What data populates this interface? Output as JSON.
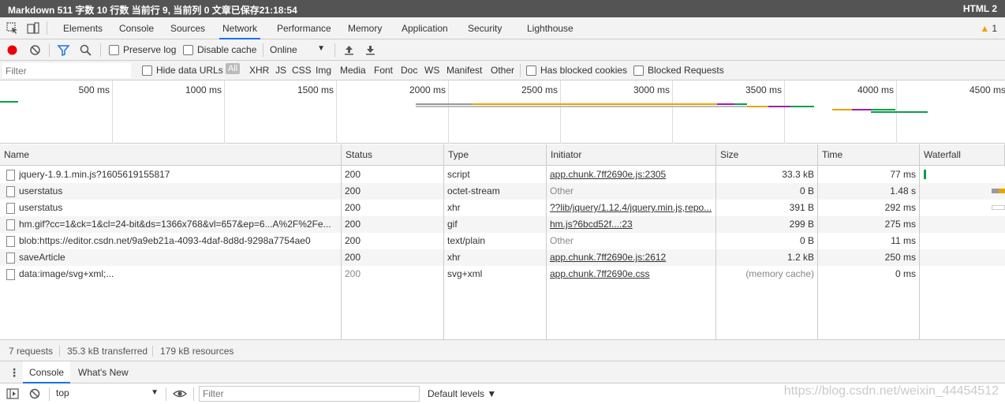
{
  "statusbar": {
    "left_text": "Markdown  511 字数  10 行数  当前行 9, 当前列 0  文章已保存21:18:54",
    "right_text": "HTML  2"
  },
  "devtools_tabs": [
    "Elements",
    "Console",
    "Sources",
    "Network",
    "Performance",
    "Memory",
    "Application",
    "Security",
    "Lighthouse"
  ],
  "active_tab": "Network",
  "warnings": {
    "icon": "warning-icon",
    "count": "1"
  },
  "toolbar": {
    "preserve_log": "Preserve log",
    "disable_cache": "Disable cache",
    "throttling": "Online"
  },
  "filterbar": {
    "placeholder": "Filter",
    "hide_data_urls": "Hide data URLs",
    "types": [
      "All",
      "XHR",
      "JS",
      "CSS",
      "Img",
      "Media",
      "Font",
      "Doc",
      "WS",
      "Manifest",
      "Other"
    ],
    "has_blocked_cookies": "Has blocked cookies",
    "blocked_requests": "Blocked Requests"
  },
  "overview": {
    "ticks": [
      "500 ms",
      "1000 ms",
      "1500 ms",
      "2000 ms",
      "2500 ms",
      "3000 ms",
      "3500 ms",
      "4000 ms",
      "4500 ms"
    ]
  },
  "table": {
    "columns": [
      "Name",
      "Status",
      "Type",
      "Initiator",
      "Size",
      "Time",
      "Waterfall"
    ],
    "rows": [
      {
        "name": "jquery-1.9.1.min.js?1605619155817",
        "status": "200",
        "type": "script",
        "initiator": "app.chunk.7ff2690e.js:2305",
        "initiator_link": true,
        "size": "33.3 kB",
        "time": "77 ms"
      },
      {
        "name": "userstatus",
        "status": "200",
        "type": "octet-stream",
        "initiator": "Other",
        "initiator_link": false,
        "size": "0 B",
        "time": "1.48 s"
      },
      {
        "name": "userstatus",
        "status": "200",
        "type": "xhr",
        "initiator": "??lib/jquery/1.12.4/jquery.min.js,repo...",
        "initiator_link": true,
        "size": "391 B",
        "time": "292 ms"
      },
      {
        "name": "hm.gif?cc=1&ck=1&cl=24-bit&ds=1366x768&vl=657&ep=6...A%2F%2Fe...",
        "status": "200",
        "type": "gif",
        "initiator": "hm.js?6bcd52f...:23",
        "initiator_link": true,
        "size": "299 B",
        "time": "275 ms"
      },
      {
        "name": "blob:https://editor.csdn.net/9a9eb21a-4093-4daf-8d8d-9298a7754ae0",
        "status": "200",
        "type": "text/plain",
        "initiator": "Other",
        "initiator_link": false,
        "size": "0 B",
        "time": "11 ms"
      },
      {
        "name": "saveArticle",
        "status": "200",
        "type": "xhr",
        "initiator": "app.chunk.7ff2690e.js:2612",
        "initiator_link": true,
        "size": "1.2 kB",
        "time": "250 ms"
      },
      {
        "name": "data:image/svg+xml;...",
        "status": "200",
        "type": "svg+xml",
        "initiator": "app.chunk.7ff2690e.css",
        "initiator_link": true,
        "size": "(memory cache)",
        "time": "0 ms"
      }
    ]
  },
  "summary": {
    "requests": "7 requests",
    "transferred": "35.3 kB transferred",
    "resources": "179 kB resources"
  },
  "drawer": {
    "tabs": [
      "Console",
      "What's New"
    ],
    "context": "top",
    "filter_placeholder": "Filter",
    "levels": "Default levels ▼"
  },
  "watermark": "https://blog.csdn.net/weixin_44454512",
  "colors": {
    "accent": "#1a73e8",
    "record": "#e8000d",
    "statusbar_bg": "#545454"
  }
}
